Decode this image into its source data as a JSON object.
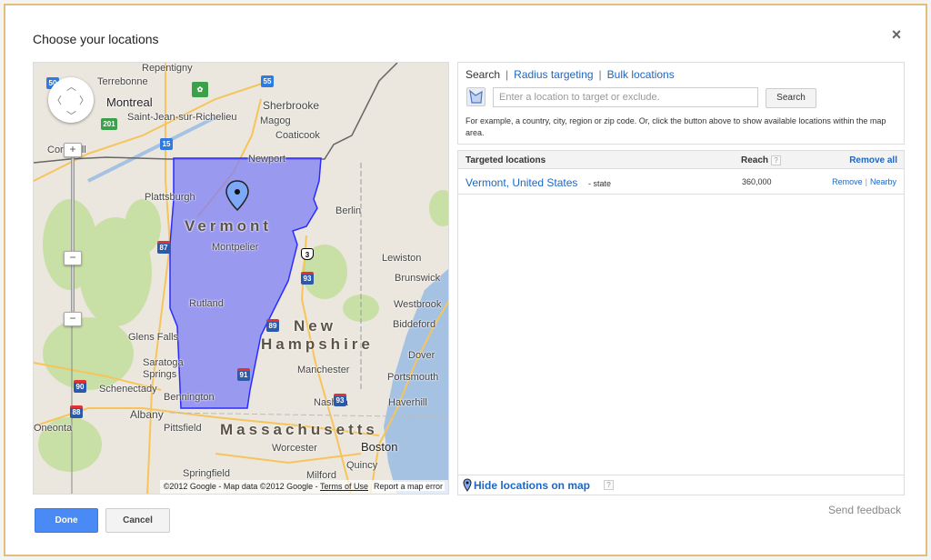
{
  "dialog": {
    "title": "Choose your locations",
    "close_icon": "×"
  },
  "map": {
    "zoom_in": "+",
    "zoom_out": "−",
    "zoom_mid": "−",
    "attribution": "©2012 Google - Map data ©2012 Google - ",
    "terms_label": "Terms of Use",
    "report_label": "Report a map error",
    "highlight_color": "#7d7ff5",
    "labels": {
      "states": [
        "Vermont",
        "New",
        "Hampshire",
        "Massachusetts"
      ],
      "cities": [
        "Repentigny",
        "Terrebonne",
        "Montreal",
        "Saint-Jean-sur-Richelieu",
        "Sherbrooke",
        "Magog",
        "Coaticook",
        "Cornwall",
        "Newport",
        "Plattsburgh",
        "Berlin",
        "Montpelier",
        "Lewiston",
        "Brunswick",
        "Rutland",
        "Westbrook",
        "Biddeford",
        "Glens Falls",
        "Dover",
        "Saratoga Springs",
        "Manchester",
        "Portsmouth",
        "Schenectady",
        "Nashua",
        "Haverhill",
        "Bennington",
        "Albany",
        "Pittsfield",
        "Worcester",
        "Boston",
        "Springfield",
        "Quincy",
        "Milford",
        "Oneonta"
      ],
      "shields": [
        "50",
        "55",
        "201",
        "15",
        "87",
        "3",
        "93",
        "89",
        "91",
        "90",
        "88",
        "93",
        "91"
      ]
    }
  },
  "search": {
    "tab_search": "Search",
    "tab_radius": "Radius targeting",
    "tab_bulk": "Bulk locations",
    "separator": "|",
    "input_placeholder": "Enter a location to target or exclude.",
    "input_value": "",
    "search_button": "Search",
    "hint": "For example, a country, city, region or zip code. Or, click the button above to show available locations within the map area."
  },
  "targets": {
    "header_location": "Targeted locations",
    "header_reach": "Reach",
    "help_icon": "?",
    "remove_all": "Remove all",
    "rows": [
      {
        "name": "Vermont, United States",
        "type": "- state",
        "reach": "360,000",
        "remove": "Remove",
        "nearby": "Nearby"
      }
    ],
    "footer_label": "Hide locations on map"
  },
  "footer": {
    "send_feedback": "Send feedback",
    "done": "Done",
    "cancel": "Cancel"
  }
}
